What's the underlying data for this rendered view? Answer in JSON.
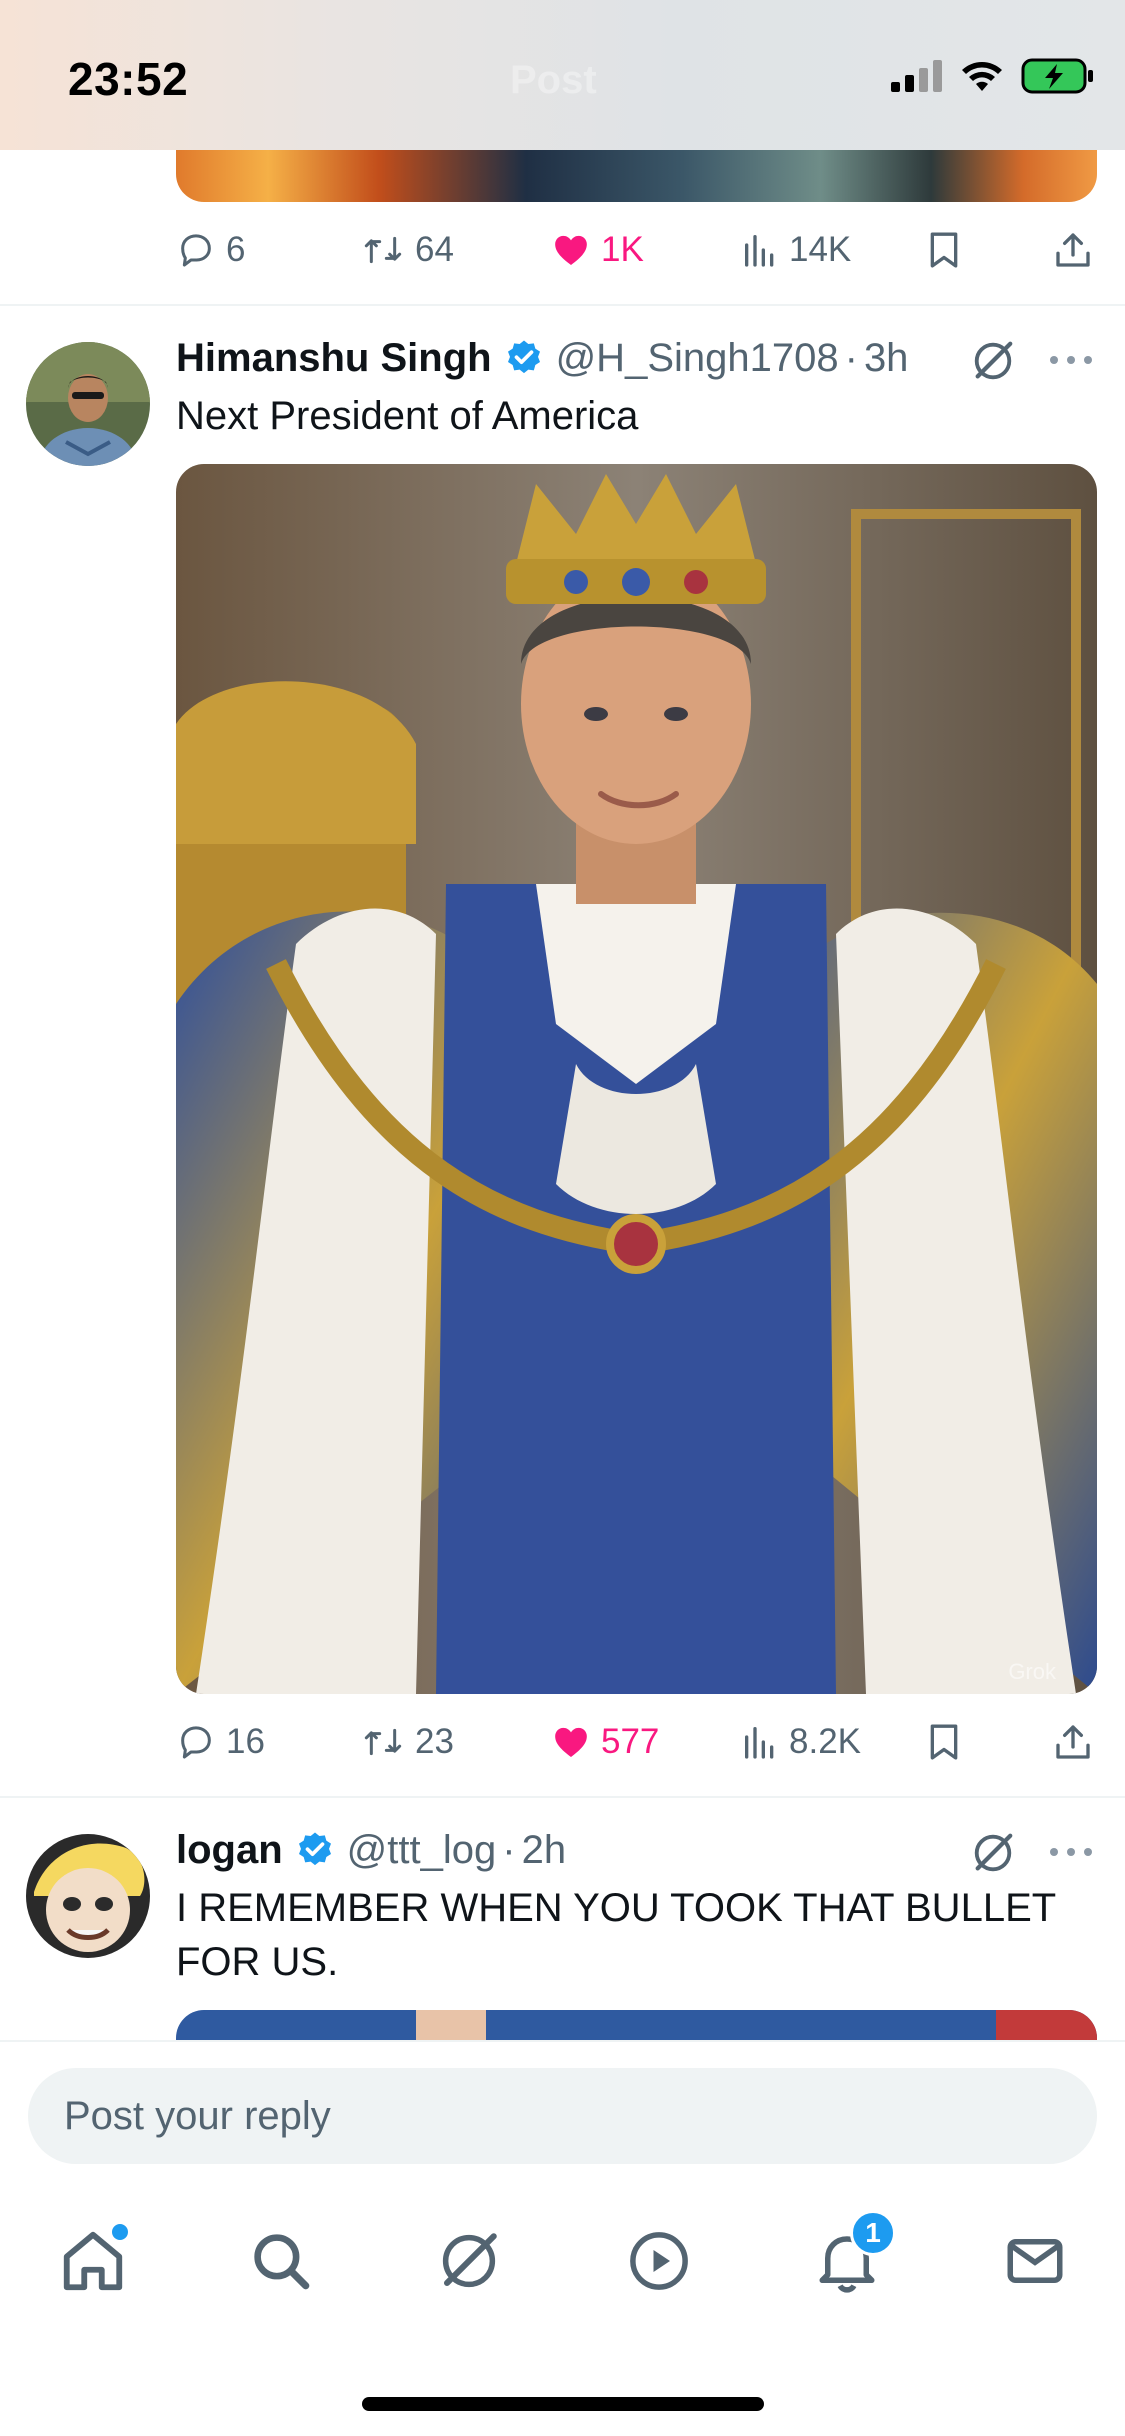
{
  "status_bar": {
    "time": "23:52",
    "ghost_title": "Post",
    "icons": [
      "signal-icon",
      "wifi-icon",
      "battery-charging-icon"
    ]
  },
  "previous_tweet": {
    "actions": {
      "replies": "6",
      "reposts": "64",
      "likes": "1K",
      "views": "14K"
    },
    "liked": true
  },
  "tweets": [
    {
      "name": "Himanshu Singh",
      "verified": true,
      "handle": "@H_Singh1708",
      "time": "3h",
      "text": "Next President of America",
      "media_watermark": "Grok",
      "actions": {
        "replies": "16",
        "reposts": "23",
        "likes": "577",
        "views": "8.2K"
      },
      "liked": true
    },
    {
      "name": "logan",
      "verified": true,
      "handle": "@ttt_log",
      "time": "2h",
      "text": "I REMEMBER WHEN YOU TOOK THAT BULLET FOR US."
    }
  ],
  "reply": {
    "placeholder": "Post your reply"
  },
  "tab_bar": {
    "tabs": [
      "home-icon",
      "search-icon",
      "grok-icon",
      "video-icon",
      "notifications-icon",
      "messages-icon"
    ],
    "notifications_badge": "1"
  },
  "colors": {
    "accent": "#1d9bf0",
    "like": "#f91880",
    "muted": "#536471",
    "text": "#0f1419"
  }
}
